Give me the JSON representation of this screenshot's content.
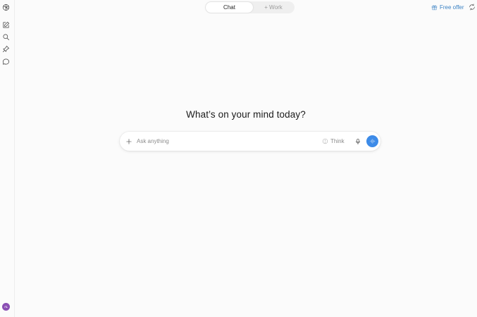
{
  "sidebar": {
    "items": [
      {
        "name": "logo-icon"
      },
      {
        "name": "new-chat-icon"
      },
      {
        "name": "search-icon"
      },
      {
        "name": "pin-icon"
      },
      {
        "name": "chat-bubble-icon"
      }
    ],
    "avatar_initials": "AL"
  },
  "header": {
    "tabs": [
      {
        "label": "Chat",
        "active": true
      },
      {
        "label": "+ Work",
        "active": false
      }
    ],
    "free_offer_label": "Free offer",
    "accent_color": "#3b82c4"
  },
  "main": {
    "headline": "What’s on your mind today?"
  },
  "composer": {
    "placeholder": "Ask anything",
    "think_label": "Think",
    "voice_button_color": "#3d8be8"
  }
}
